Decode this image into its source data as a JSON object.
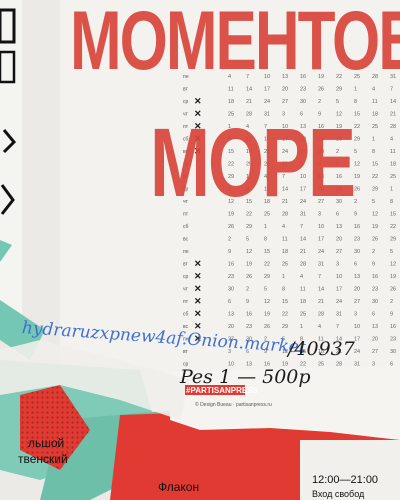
{
  "poster": {
    "headline_line1": "МОМЕНТОВ",
    "headline_line2": "МОРЕ",
    "hashtag": "#PARTISANPRESS",
    "fine_print": "© Design Bueau · partisanpress.ru",
    "colors": {
      "paper": "#e9e8e4",
      "headline_red": "#d8453b",
      "poster_red": "#e03a33",
      "mint": "#74c7b2",
      "ink_blue": "#3f6fd1",
      "ink_black": "#1c1c1c"
    }
  },
  "calendar": {
    "weekday_labels": [
      "пн",
      "вт",
      "ср",
      "чт",
      "пт",
      "сб",
      "вс"
    ],
    "rows_with_cross_marks": [
      2,
      3,
      4,
      5,
      6,
      15,
      16,
      17,
      18,
      19,
      20,
      21
    ]
  },
  "graffiti": {
    "blue_scrawl": "hydraruzxpnew4af.Onion.market",
    "black_number": "/40937",
    "price_note": "Pes 1 — 500р"
  },
  "lower_poster": {
    "left_line1": "льшой",
    "left_line2": "твенский",
    "center_word": "Флакон",
    "right_time": "12:00—21:00",
    "right_sub": "Вход свобод"
  }
}
